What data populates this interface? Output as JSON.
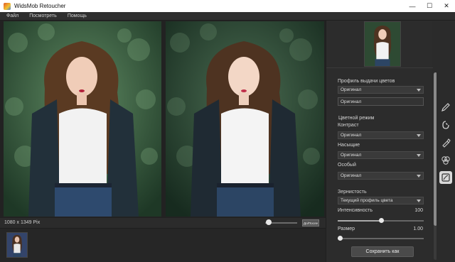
{
  "window": {
    "title": "WidsMob Retoucher",
    "minimize_glyph": "—",
    "maximize_glyph": "☐",
    "close_glyph": "✕"
  },
  "menu": [
    "Файл",
    "Посмотреть",
    "Помощь"
  ],
  "status": {
    "dimensions": "1080 x 1349 Pix",
    "before_after_label": "До/После",
    "zoom_level": 0.1
  },
  "panel": {
    "color_profile_label": "Профиль выдачи цветов",
    "color_profile_value": "Оригинал",
    "color_profile_field": "Оригинал",
    "color_mode_label": "Цветной режим",
    "contrast_label": "Контраст",
    "contrast_value": "Оригинал",
    "saturation_label": "Насыщие",
    "saturation_value": "Оригинал",
    "special_label": "Особый",
    "special_value": "Оригинал",
    "grain_label": "Зернистость",
    "grain_profile_value": "Текущий профиль цвета",
    "intensity_label": "Интенсивность",
    "intensity_value": "100",
    "intensity_fraction": 0.5,
    "size_label": "Размер",
    "size_value": "1.00",
    "size_fraction": 0.02,
    "save_button": "Сохранить как"
  },
  "tools": [
    "pencil-icon",
    "retouch-icon",
    "brush-icon",
    "color-circles-icon",
    "frame-icon"
  ],
  "colors": {
    "background": "#2b2b2b",
    "panel": "#2c2c2c",
    "titlebar": "#ffffff",
    "accent_active_tool": "#d9d9d9"
  }
}
